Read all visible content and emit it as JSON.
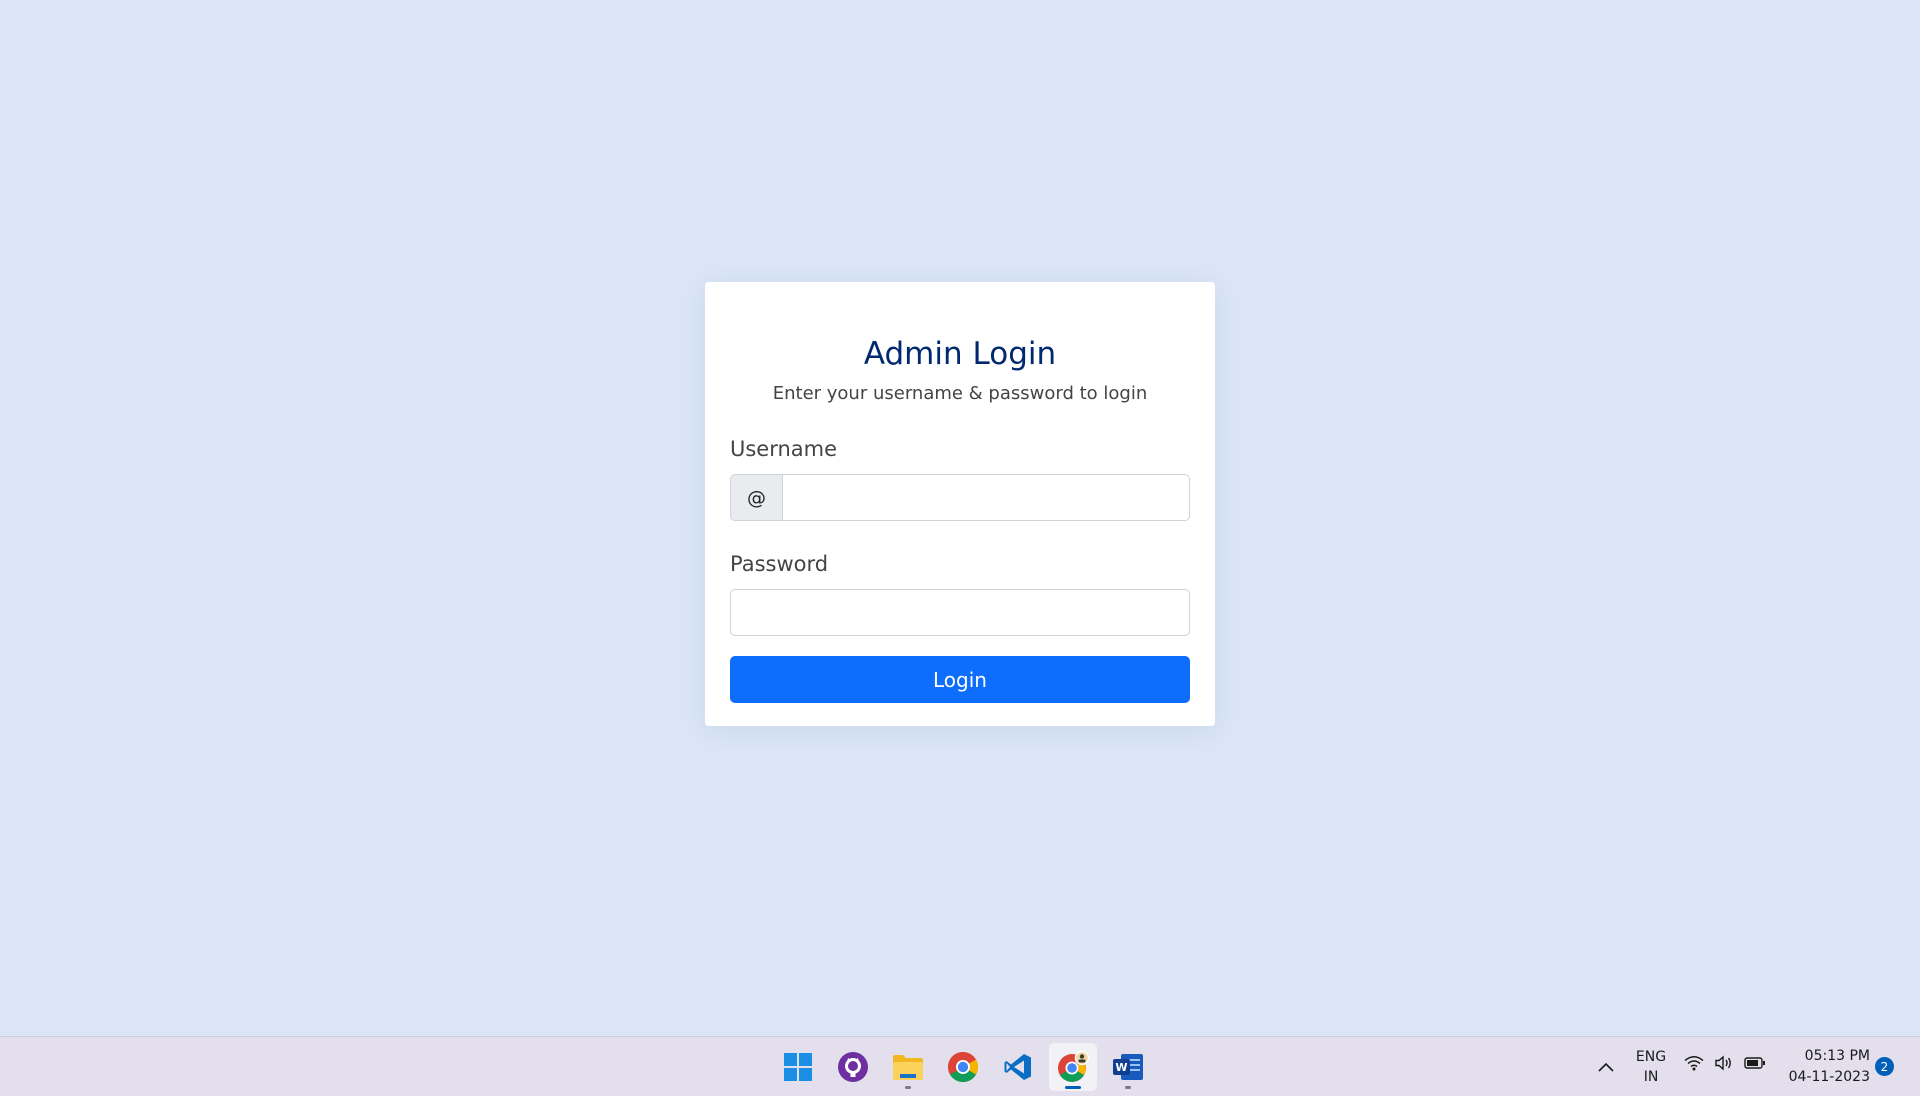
{
  "login": {
    "title": "Admin Login",
    "subtitle": "Enter your username & password to login",
    "username_label": "Username",
    "username_prefix": "@",
    "username_value": "",
    "password_label": "Password",
    "password_value": "",
    "submit_label": "Login"
  },
  "taskbar": {
    "apps": [
      {
        "name": "start-menu",
        "icon": "windows-icon",
        "running": false,
        "active": false
      },
      {
        "name": "github-desktop",
        "icon": "github-icon",
        "running": false,
        "active": false
      },
      {
        "name": "file-explorer",
        "icon": "folder-icon",
        "running": true,
        "active": false
      },
      {
        "name": "chrome",
        "icon": "chrome-icon",
        "running": false,
        "active": false
      },
      {
        "name": "vscode",
        "icon": "vscode-icon",
        "running": false,
        "active": false
      },
      {
        "name": "chrome-profile",
        "icon": "chrome-profile-icon",
        "running": true,
        "active": true
      },
      {
        "name": "word",
        "icon": "word-icon",
        "running": true,
        "active": false
      }
    ],
    "language_line1": "ENG",
    "language_line2": "IN",
    "time": "05:13 PM",
    "date": "04-11-2023",
    "notification_count": "2"
  },
  "colors": {
    "page_background": "#dae6f7",
    "title": "#012970",
    "primary_button": "#0d6efd"
  }
}
